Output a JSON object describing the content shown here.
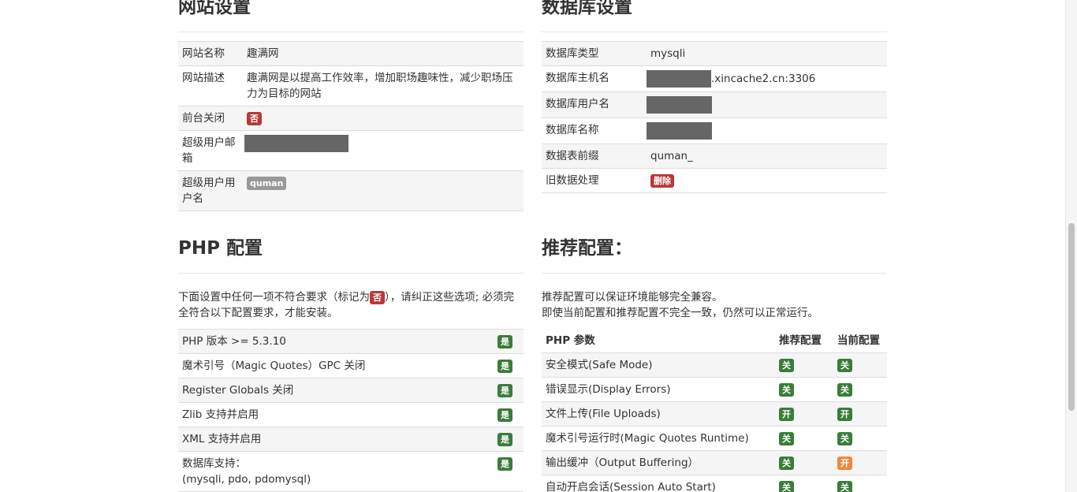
{
  "site": {
    "title": "网站设置",
    "rows": [
      {
        "label": "网站名称",
        "value": "趣满网"
      },
      {
        "label": "网站描述",
        "value": "趣满网是以提高工作效率，增加职场趣味性，减少职场压力为目标的网站"
      },
      {
        "label": "前台关闭",
        "badge": "否"
      },
      {
        "label": "超级用户邮箱"
      },
      {
        "label": "超级用户用户名",
        "badge": "quman"
      }
    ]
  },
  "db": {
    "title": "数据库设置",
    "rows": [
      {
        "label": "数据库类型",
        "value": "mysqli"
      },
      {
        "label": "数据库主机名",
        "value": ".xincache2.cn:3306"
      },
      {
        "label": "数据库用户名"
      },
      {
        "label": "数据库名称"
      },
      {
        "label": "数据表前缀",
        "value": "quman_"
      },
      {
        "label": "旧数据处理",
        "badge": "删除"
      }
    ]
  },
  "php": {
    "title": "PHP 配置",
    "desc_before": "下面设置中任何一项不符合要求（标记为",
    "desc_badge": "否",
    "desc_after": "），请纠正这些选项; 必须完全符合以下配置要求，才能安装。",
    "rows": [
      {
        "label": "PHP 版本 >= 5.3.10",
        "badge": "是"
      },
      {
        "label": "魔术引号（Magic Quotes）GPC 关闭",
        "badge": "是"
      },
      {
        "label": "Register Globals 关闭",
        "badge": "是"
      },
      {
        "label": "Zlib 支持并启用",
        "badge": "是"
      },
      {
        "label": "XML 支持并启用",
        "badge": "是"
      },
      {
        "label": "数据库支持：",
        "label2": "(mysqli, pdo, pdomysql)",
        "badge": "是"
      }
    ]
  },
  "rec": {
    "title": "推荐配置：",
    "desc1": "推荐配置可以保证环境能够完全兼容。",
    "desc2": "即使当前配置和推荐配置不完全一致，仍然可以正常运行。",
    "headers": [
      "PHP 参数",
      "推荐配置",
      "当前配置"
    ],
    "rows": [
      {
        "label": "安全模式(Safe Mode)",
        "rec": "关",
        "cur": "关",
        "cur_color": "#3a7d3a"
      },
      {
        "label": "错误显示(Display Errors)",
        "rec": "关",
        "cur": "关",
        "cur_color": "#3a7d3a"
      },
      {
        "label": "文件上传(File Uploads)",
        "rec": "开",
        "cur": "开",
        "cur_color": "#3a7d3a"
      },
      {
        "label": "魔术引号运行时(Magic Quotes Runtime)",
        "rec": "关",
        "cur": "关",
        "cur_color": "#3a7d3a"
      },
      {
        "label": "输出缓冲（Output Buffering）",
        "rec": "关",
        "cur": "开",
        "cur_color": "#f0883a"
      },
      {
        "label": "自动开启会话(Session Auto Start)",
        "rec": "关",
        "cur": "关",
        "cur_color": "#3a7d3a"
      }
    ]
  }
}
